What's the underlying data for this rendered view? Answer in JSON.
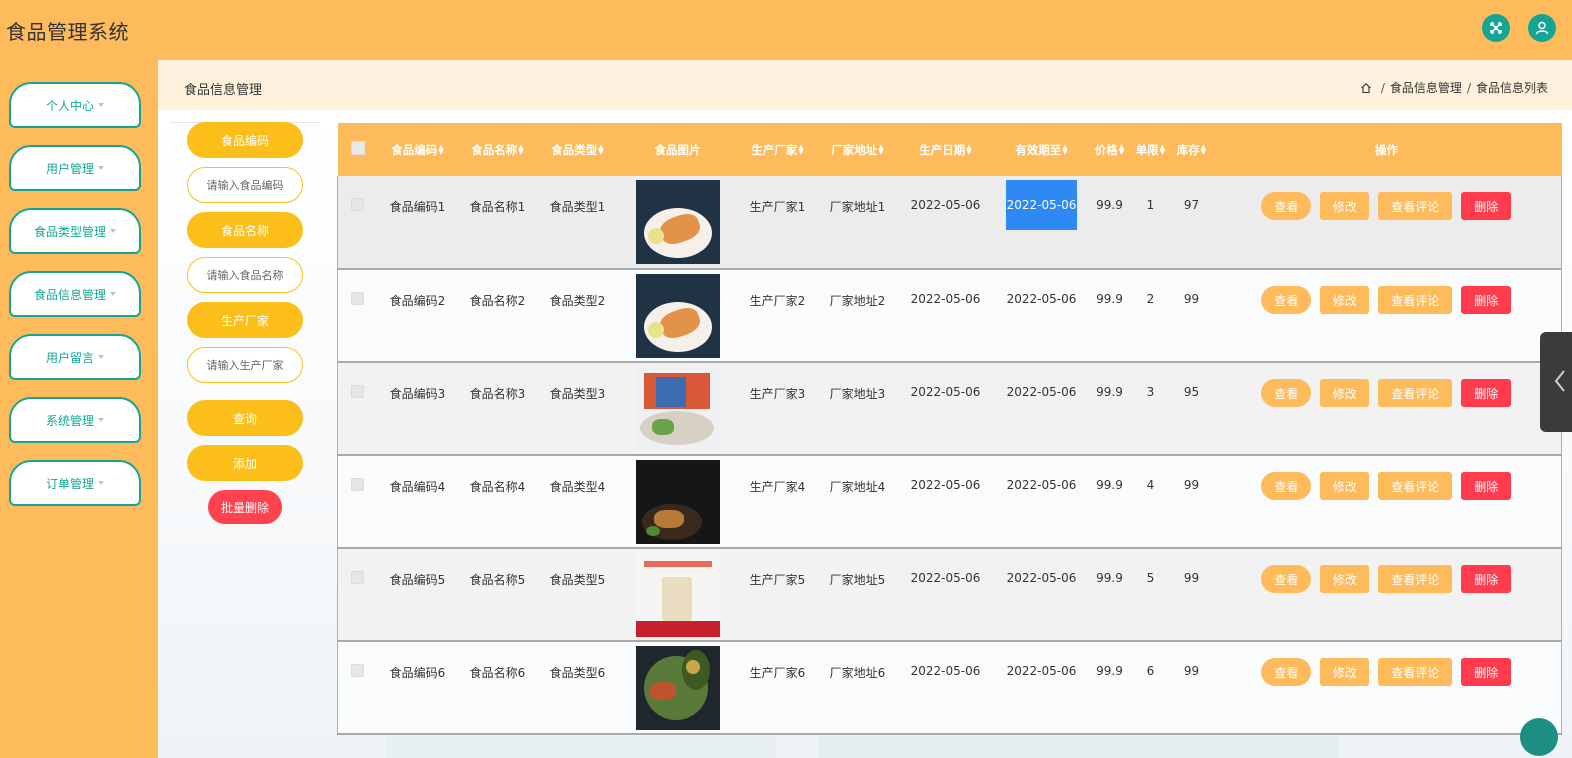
{
  "app": {
    "title": "食品管理系统"
  },
  "header": {
    "icons": [
      "fullscreen-icon",
      "user-icon"
    ]
  },
  "sidebar": {
    "items": [
      {
        "label": "个人中心"
      },
      {
        "label": "用户管理"
      },
      {
        "label": "食品类型管理"
      },
      {
        "label": "食品信息管理"
      },
      {
        "label": "用户留言"
      },
      {
        "label": "系统管理"
      },
      {
        "label": "订单管理"
      }
    ]
  },
  "page": {
    "title": "食品信息管理",
    "breadcrumb": [
      "食品信息管理",
      "食品信息列表"
    ]
  },
  "search": {
    "code_label": "食品编码",
    "code_placeholder": "请输入食品编码",
    "name_label": "食品名称",
    "name_placeholder": "请输入食品名称",
    "maker_label": "生产厂家",
    "maker_placeholder": "请输入生产厂家",
    "query_button": "查询",
    "add_button": "添加",
    "batch_delete_button": "批量删除"
  },
  "table": {
    "columns": [
      "食品编码",
      "食品名称",
      "食品类型",
      "食品图片",
      "生产厂家",
      "厂家地址",
      "生产日期",
      "有效期至",
      "价格",
      "单限",
      "库存",
      "操作"
    ],
    "actions": {
      "view": "查看",
      "edit": "修改",
      "review": "查看评论",
      "delete": "删除"
    },
    "rows": [
      {
        "code": "食品编码1",
        "name": "食品名称1",
        "type": "食品类型1",
        "maker": "生产厂家1",
        "addr": "厂家地址1",
        "prod": "2022-05-06",
        "expire": "2022-05-06",
        "price": "99.9",
        "limit": "1",
        "stock": "97"
      },
      {
        "code": "食品编码2",
        "name": "食品名称2",
        "type": "食品类型2",
        "maker": "生产厂家2",
        "addr": "厂家地址2",
        "prod": "2022-05-06",
        "expire": "2022-05-06",
        "price": "99.9",
        "limit": "2",
        "stock": "99"
      },
      {
        "code": "食品编码3",
        "name": "食品名称3",
        "type": "食品类型3",
        "maker": "生产厂家3",
        "addr": "厂家地址3",
        "prod": "2022-05-06",
        "expire": "2022-05-06",
        "price": "99.9",
        "limit": "3",
        "stock": "95"
      },
      {
        "code": "食品编码4",
        "name": "食品名称4",
        "type": "食品类型4",
        "maker": "生产厂家4",
        "addr": "厂家地址4",
        "prod": "2022-05-06",
        "expire": "2022-05-06",
        "price": "99.9",
        "limit": "4",
        "stock": "99"
      },
      {
        "code": "食品编码5",
        "name": "食品名称5",
        "type": "食品类型5",
        "maker": "生产厂家5",
        "addr": "厂家地址5",
        "prod": "2022-05-06",
        "expire": "2022-05-06",
        "price": "99.9",
        "limit": "5",
        "stock": "99"
      },
      {
        "code": "食品编码6",
        "name": "食品名称6",
        "type": "食品类型6",
        "maker": "生产厂家6",
        "addr": "厂家地址6",
        "prod": "2022-05-06",
        "expire": "2022-05-06",
        "price": "99.9",
        "limit": "6",
        "stock": "99"
      }
    ]
  },
  "colors": {
    "primary": "#fdbb5c",
    "accent": "#16a593",
    "pill": "#fcbf1a",
    "danger": "#ff3b4d",
    "selection": "#2f89f5"
  }
}
